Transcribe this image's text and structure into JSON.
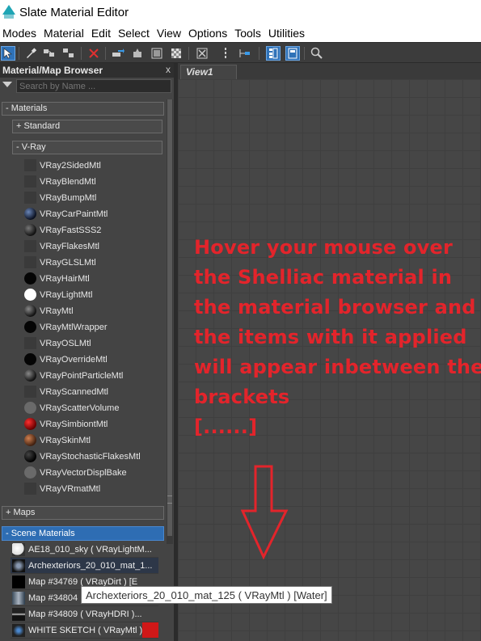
{
  "window": {
    "title": "Slate Material Editor"
  },
  "menu": [
    "Modes",
    "Material",
    "Edit",
    "Select",
    "View",
    "Options",
    "Tools",
    "Utilities"
  ],
  "toolbar": {
    "icons": [
      "select-arrow-icon",
      "eyedropper-icon",
      "assign-material-icon",
      "put-to-scene-icon",
      "delete-icon",
      "move-children-icon",
      "hide-unused-icon",
      "layout-all-icon",
      "layout-children-icon",
      "show-background-icon",
      "nav-icon",
      "select-tree-icon",
      "material-map-browser-icon",
      "parameter-editor-icon",
      "zoom-extents-icon"
    ]
  },
  "browser": {
    "title": "Material/Map Browser",
    "close": "x",
    "search_placeholder": "Search by Name ...",
    "materials_header": "- Materials",
    "standard_header": "+ Standard",
    "vray_header": "- V-Ray",
    "vray_items": [
      {
        "label": "VRay2SidedMtl",
        "swatch": "#3a3a3a",
        "round": false
      },
      {
        "label": "VRayBlendMtl",
        "swatch": "#3a3a3a",
        "round": false
      },
      {
        "label": "VRayBumpMtl",
        "swatch": "#3a3a3a",
        "round": false
      },
      {
        "label": "VRayCarPaintMtl",
        "swatch": "radial-gradient(circle at 35% 35%, #6a86b8, #0a1020 70%)",
        "round": true
      },
      {
        "label": "VRayFastSSS2",
        "swatch": "radial-gradient(circle at 35% 35%, #777, #111 70%)",
        "round": true
      },
      {
        "label": "VRayFlakesMtl",
        "swatch": "#3a3a3a",
        "round": false
      },
      {
        "label": "VRayGLSLMtl",
        "swatch": "#3a3a3a",
        "round": false
      },
      {
        "label": "VRayHairMtl",
        "swatch": "#050505",
        "round": true
      },
      {
        "label": "VRayLightMtl",
        "swatch": "#ffffff",
        "round": true
      },
      {
        "label": "VRayMtl",
        "swatch": "radial-gradient(circle at 35% 35%, #888, #111 70%)",
        "round": true
      },
      {
        "label": "VRayMtlWrapper",
        "swatch": "#050505",
        "round": true
      },
      {
        "label": "VRayOSLMtl",
        "swatch": "#3a3a3a",
        "round": false
      },
      {
        "label": "VRayOverrideMtl",
        "swatch": "#050505",
        "round": true
      },
      {
        "label": "VRayPointParticleMtl",
        "swatch": "radial-gradient(circle at 35% 35%, #888, #111 70%)",
        "round": true
      },
      {
        "label": "VRayScannedMtl",
        "swatch": "#3a3a3a",
        "round": false
      },
      {
        "label": "VRayScatterVolume",
        "swatch": "#6a6a6a",
        "round": true
      },
      {
        "label": "VRaySimbiontMtl",
        "swatch": "radial-gradient(circle at 35% 35%, #ff3030, #600 70%)",
        "round": true
      },
      {
        "label": "VRaySkinMtl",
        "swatch": "radial-gradient(circle at 35% 35%, #d08050, #402010 70%)",
        "round": true
      },
      {
        "label": "VRayStochasticFlakesMtl",
        "swatch": "radial-gradient(circle at 35% 35%, #444, #000 70%)",
        "round": true
      },
      {
        "label": "VRayVectorDisplBake",
        "swatch": "#6a6a6a",
        "round": true
      },
      {
        "label": "VRayVRmatMtl",
        "swatch": "#3a3a3a",
        "round": false
      }
    ],
    "maps_header": "+ Maps",
    "scene_header": "- Scene Materials",
    "scene_items": [
      {
        "label": "AE18_010_sky  ( VRayLightM...",
        "swatch": "radial-gradient(circle at 40% 40%, #fff, #ddd 60%, #333 62%)"
      },
      {
        "label": "Archexteriors_20_010_mat_1...",
        "swatch": "radial-gradient(circle, #8898b0 20%, #111 70%)"
      },
      {
        "label": "Map #34769  ( VRayDirt ) [E",
        "swatch": "#000000"
      },
      {
        "label": "Map #34804",
        "swatch": "linear-gradient(90deg, #3a4a5a, #aab4c0, #2a3a4a)"
      },
      {
        "label": "Map #34809  ( VRayHDRI )...",
        "swatch": "linear-gradient(180deg, #222 40%, #ccc 50%, #111 60%)"
      },
      {
        "label": "WHITE SKETCH  ( VRayMtl )...",
        "swatch": "radial-gradient(circle, #4a88cf 15%, #222 60%)"
      }
    ]
  },
  "view": {
    "tab": "View1"
  },
  "annotation": {
    "lines": [
      "Hover your mouse over",
      "the Shelliac material in",
      "the material browser and",
      "the items with it applied",
      "will appear inbetween the",
      "brackets",
      "[......]"
    ],
    "color": "#e3242b"
  },
  "tooltip": {
    "text": "Archexteriors_20_010_mat_125  ( VRayMtl )  [Water]"
  }
}
